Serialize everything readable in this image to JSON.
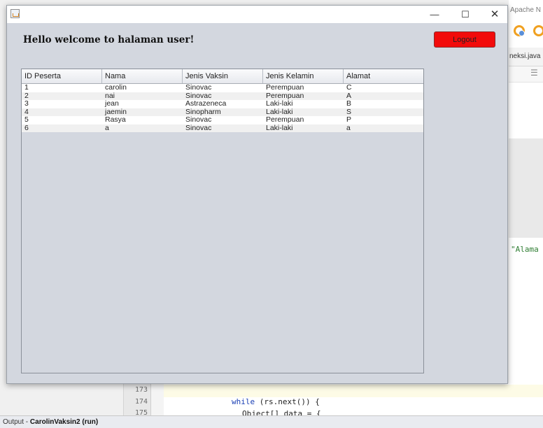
{
  "ide": {
    "top_title": "Apache N",
    "tab_label": "neksi.java",
    "code_string": "\"Alama",
    "line_numbers": [
      "173",
      "174",
      "175"
    ],
    "code_line_keyword": "while",
    "code_line_rest": " (rs.next()) {",
    "code_line_rs": "rs",
    "code_line2": "Object[] data = {",
    "output_prefix": "Output - ",
    "output_project": "CarolinVaksin2 (run)"
  },
  "window": {
    "controls": {
      "minimize": "—",
      "maximize": "☐",
      "close": "✕"
    },
    "welcome": "Hello welcome to halaman user!",
    "logout_label": "Logout",
    "colors": {
      "logout_bg": "#f20b0b",
      "panel_bg": "#d3d7df"
    }
  },
  "table": {
    "headers": [
      "ID Peserta",
      "Nama",
      "Jenis Vaksin",
      "Jenis Kelamin",
      "Alamat"
    ],
    "rows": [
      [
        "1",
        "carolin",
        "Sinovac",
        "Perempuan",
        "C"
      ],
      [
        "2",
        "nai",
        "Sinovac",
        "Perempuan",
        "A"
      ],
      [
        "3",
        "jean",
        "Astrazeneca",
        "Laki-laki",
        "B"
      ],
      [
        "4",
        "jaemin",
        "Sinopharm",
        "Laki-laki",
        "S"
      ],
      [
        "5",
        "Rasya",
        "Sinovac",
        "Perempuan",
        "P"
      ],
      [
        "6",
        "a",
        "Sinovac",
        "Laki-laki",
        "a"
      ]
    ]
  }
}
